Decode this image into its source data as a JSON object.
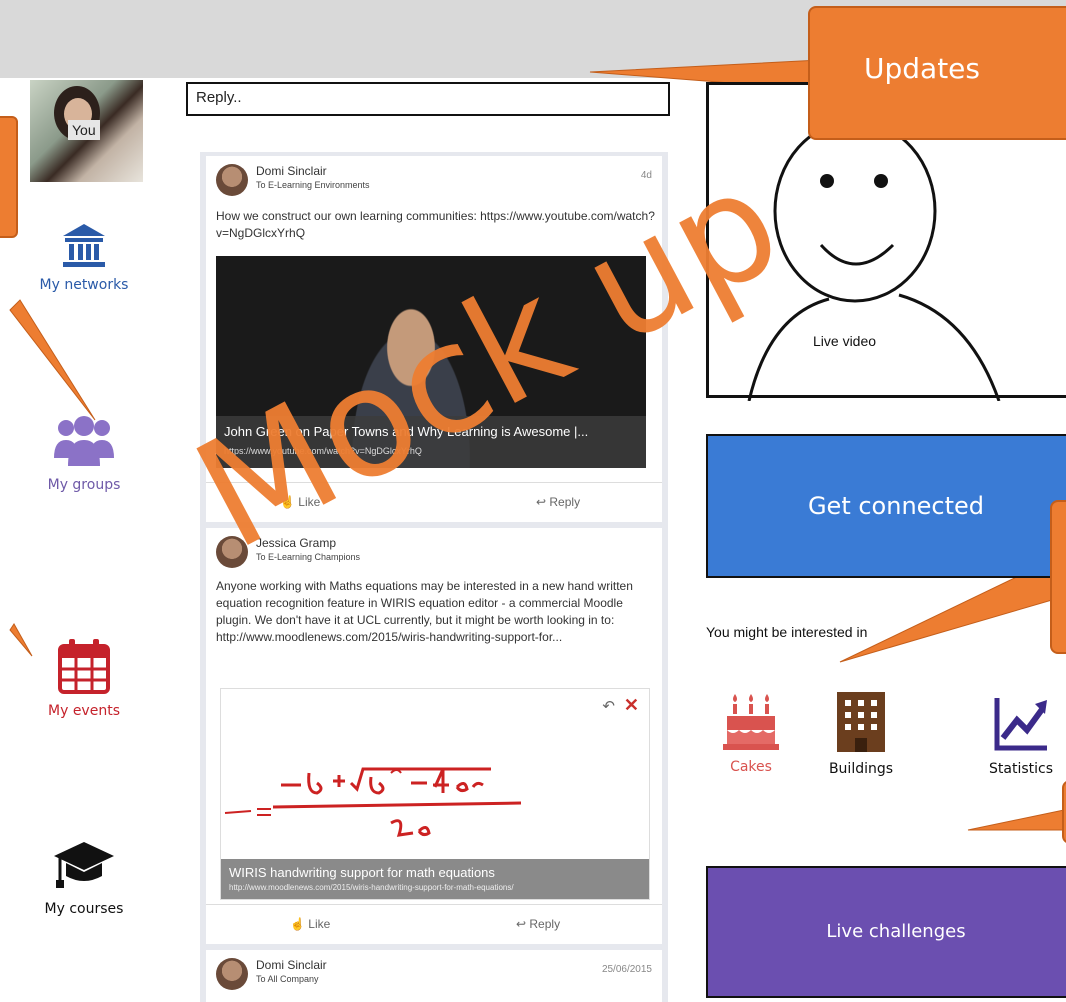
{
  "nav": {
    "avatar_label": "You",
    "items": [
      {
        "label": "My networks",
        "icon": "bank-icon",
        "color": "#2a5aa8"
      },
      {
        "label": "My groups",
        "icon": "group-icon",
        "color": "#8b72c7"
      },
      {
        "label": "My events",
        "icon": "calendar-icon",
        "color": "#c5222b"
      },
      {
        "label": "My courses",
        "icon": "graduation-cap-icon",
        "color": "#111111"
      }
    ]
  },
  "feed": {
    "reply_placeholder": "Reply..",
    "posts": [
      {
        "author": "Domi Sinclair",
        "audience": "To E-Learning Environments",
        "time": "4d",
        "text": "How we construct our own learning communities: https://www.youtube.com/watch?v=NgDGlcxYrhQ",
        "media_title": "John Green on Paper Towns and Why Learning is Awesome |...",
        "media_url": "https://www.youtube.com/watch?v=NgDGlcxYrhQ",
        "like": "Like",
        "reply": "Reply"
      },
      {
        "author": "Jessica Gramp",
        "audience": "To E-Learning Champions",
        "time": "",
        "text": "Anyone working with Maths equations may be interested in a new hand written equation recognition feature in WIRIS equation editor - a commercial Moodle plugin. We don't have it at UCL currently, but it might be worth looking in to: http://www.moodlenews.com/2015/wiris-handwriting-support-for...",
        "media_title": "WIRIS handwriting support for math equations",
        "media_url": "http://www.moodlenews.com/2015/wiris-handwriting-support-for-math-equations/",
        "like": "Like",
        "reply": "Reply"
      },
      {
        "author": "Domi Sinclair",
        "audience": "To All Company",
        "time": "25/06/2015"
      }
    ]
  },
  "right": {
    "video_label": "Live video",
    "connect_label": "Get connected",
    "interest_heading": "You might be interested in",
    "interests": [
      {
        "label": "Cakes",
        "icon": "cake-icon",
        "color": "#d9534f"
      },
      {
        "label": "Buildings",
        "icon": "building-icon",
        "color": "#6b3e1e"
      },
      {
        "label": "Statistics",
        "icon": "chart-line-icon",
        "color": "#3b2a8a"
      }
    ],
    "challenges_label": "Live challenges"
  },
  "callouts": {
    "updates": "Updates"
  },
  "watermark": "Mock up",
  "colors": {
    "accent_orange": "#ed7d31",
    "connect_blue": "#3a7bd5",
    "challenges_purple": "#6b4fb0"
  }
}
